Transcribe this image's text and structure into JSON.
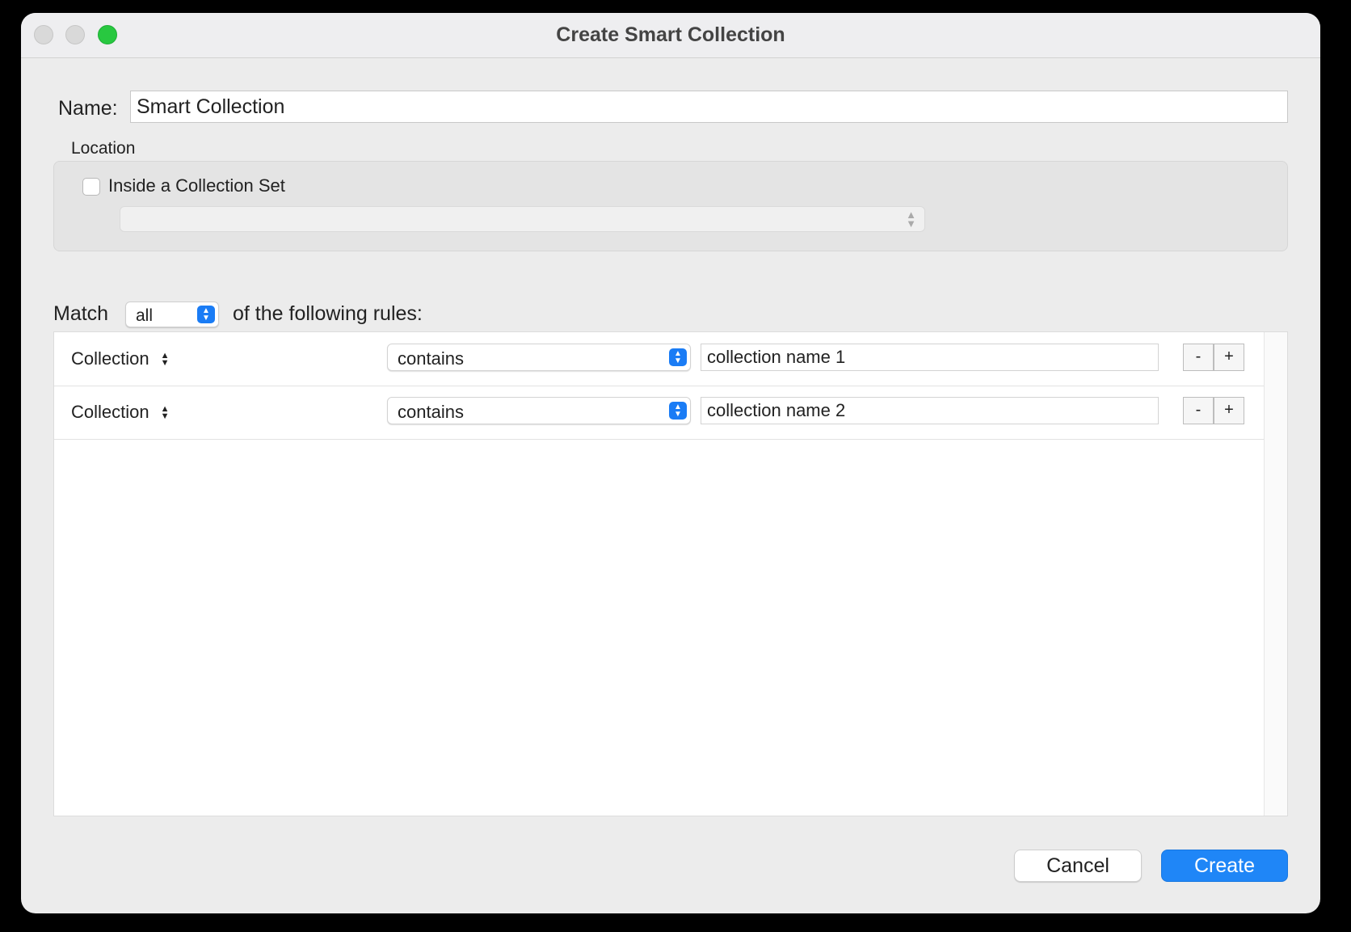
{
  "window": {
    "title": "Create Smart Collection"
  },
  "name": {
    "label": "Name:",
    "value": "Smart Collection"
  },
  "location": {
    "label": "Location",
    "checkbox_label": "Inside a Collection Set",
    "checked": false,
    "set_value": ""
  },
  "match": {
    "prefix": "Match",
    "value": "all",
    "suffix": "of the following rules:"
  },
  "rules": [
    {
      "field": "Collection",
      "operator": "contains",
      "value": "collection name 1",
      "remove": "-",
      "add": "+"
    },
    {
      "field": "Collection",
      "operator": "contains",
      "value": "collection name 2",
      "remove": "-",
      "add": "+"
    }
  ],
  "buttons": {
    "cancel": "Cancel",
    "create": "Create"
  },
  "colors": {
    "accent": "#1f86f7",
    "zoom_button": "#28c840"
  }
}
